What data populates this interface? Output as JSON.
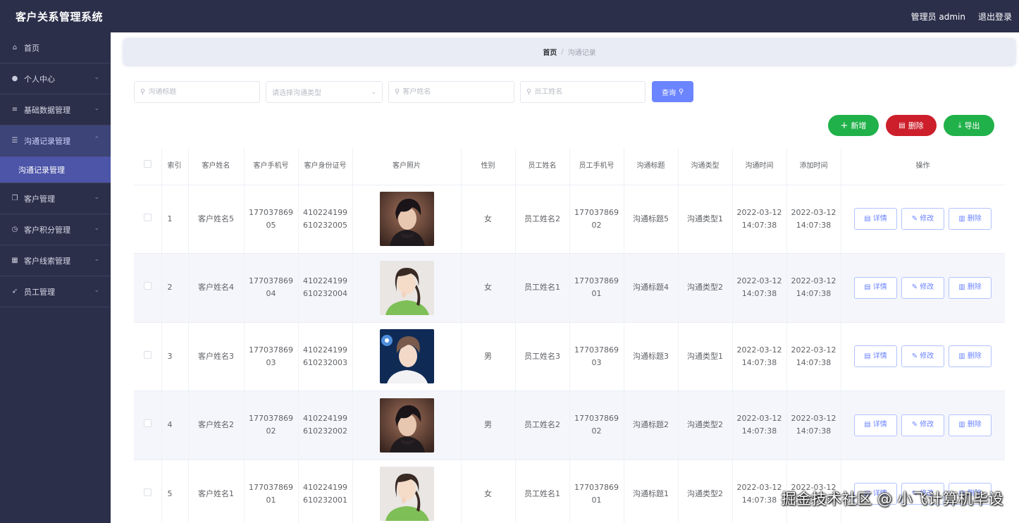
{
  "app": {
    "title": "客户关系管理系统"
  },
  "header": {
    "user_label": "管理员 admin",
    "logout_label": "退出登录"
  },
  "sidebar": {
    "items": [
      {
        "label": "首页",
        "icon": "home-icon",
        "glyph": "⌂",
        "has_children": false
      },
      {
        "label": "个人中心",
        "icon": "user-icon",
        "glyph": "●",
        "has_children": true
      },
      {
        "label": "基础数据管理",
        "icon": "list-icon",
        "glyph": "≡",
        "has_children": true
      },
      {
        "label": "沟通记录管理",
        "icon": "menu-icon",
        "glyph": "☰",
        "has_children": true,
        "active": true
      },
      {
        "label": "客户管理",
        "icon": "copy-icon",
        "glyph": "❐",
        "has_children": true
      },
      {
        "label": "客户积分管理",
        "icon": "clock-icon",
        "glyph": "◷",
        "has_children": true
      },
      {
        "label": "客户线索管理",
        "icon": "grid-icon",
        "glyph": "▦",
        "has_children": true
      },
      {
        "label": "员工管理",
        "icon": "send-icon",
        "glyph": "➶",
        "has_children": true
      }
    ],
    "submenu_label": "沟通记录管理"
  },
  "breadcrumb": {
    "home": "首页",
    "separator": "/",
    "current": "沟通记录"
  },
  "search": {
    "title_placeholder": "沟通标题",
    "type_placeholder": "请选择沟通类型",
    "customer_placeholder": "客户姓名",
    "employee_placeholder": "员工姓名",
    "query_label": "查询"
  },
  "actions": {
    "add_label": "新增",
    "delete_label": "删除",
    "export_label": "导出"
  },
  "table": {
    "columns": [
      "索引",
      "客户姓名",
      "客户手机号",
      "客户身份证号",
      "客户照片",
      "性别",
      "员工姓名",
      "员工手机号",
      "沟通标题",
      "沟通类型",
      "沟通时间",
      "添加时间",
      "操作"
    ],
    "row_actions": {
      "detail": "详情",
      "edit": "修改",
      "delete": "删除"
    },
    "rows": [
      {
        "index": "1",
        "customer_name": "客户姓名5",
        "customer_phone": "17703786905",
        "customer_id": "410224199610232005",
        "photo": "male-dark",
        "gender": "女",
        "employee_name": "员工姓名2",
        "employee_phone": "17703786902",
        "title": "沟通标题5",
        "type": "沟通类型1",
        "comm_time": "2022-03-12 14:07:38",
        "add_time": "2022-03-12 14:07:38"
      },
      {
        "index": "2",
        "customer_name": "客户姓名4",
        "customer_phone": "17703786904",
        "customer_id": "410224199610232004",
        "photo": "female-green",
        "gender": "女",
        "employee_name": "员工姓名1",
        "employee_phone": "17703786901",
        "title": "沟通标题4",
        "type": "沟通类型2",
        "comm_time": "2022-03-12 14:07:38",
        "add_time": "2022-03-12 14:07:38"
      },
      {
        "index": "3",
        "customer_name": "客户姓名3",
        "customer_phone": "17703786903",
        "customer_id": "410224199610232003",
        "photo": "male-blue",
        "gender": "男",
        "employee_name": "员工姓名3",
        "employee_phone": "17703786903",
        "title": "沟通标题3",
        "type": "沟通类型1",
        "comm_time": "2022-03-12 14:07:38",
        "add_time": "2022-03-12 14:07:38"
      },
      {
        "index": "4",
        "customer_name": "客户姓名2",
        "customer_phone": "17703786902",
        "customer_id": "410224199610232002",
        "photo": "male-dark",
        "gender": "男",
        "employee_name": "员工姓名2",
        "employee_phone": "17703786902",
        "title": "沟通标题2",
        "type": "沟通类型2",
        "comm_time": "2022-03-12 14:07:38",
        "add_time": "2022-03-12 14:07:38"
      },
      {
        "index": "5",
        "customer_name": "客户姓名1",
        "customer_phone": "17703786901",
        "customer_id": "410224199610232001",
        "photo": "female-green",
        "gender": "女",
        "employee_name": "员工姓名1",
        "employee_phone": "17703786901",
        "title": "沟通标题1",
        "type": "沟通类型2",
        "comm_time": "2022-03-12 14:07:38",
        "add_time": "2022-03-12 14:07:38"
      }
    ]
  },
  "watermark": "掘金技术社区 @ 小飞计算机毕设",
  "colors": {
    "sidebar_bg": "#2b2f4a",
    "submenu_active": "#4c55a8",
    "primary": "#6b84ff",
    "success": "#21b14a",
    "danger": "#cc1f2b"
  }
}
